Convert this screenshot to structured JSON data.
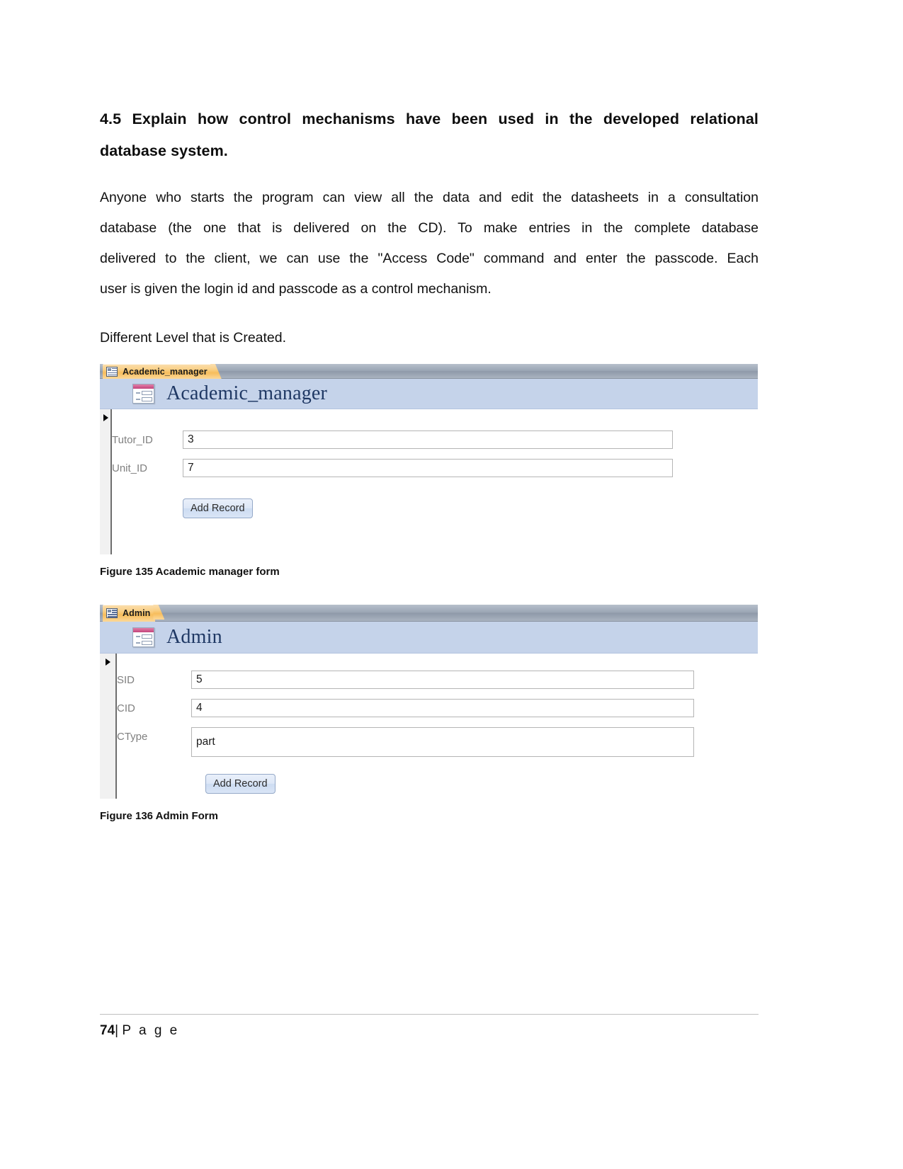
{
  "document": {
    "heading": {
      "line1": "4.5  Explain  how  control  mechanisms  have  been  used  in  the  developed  relational",
      "line2": "database system."
    },
    "paragraph1": {
      "line1": "Anyone who starts the program can view all the data and edit the datasheets in a consultation",
      "line2": "database  (the  one  that  is  delivered  on  the  CD).  To  make  entries  in  the  complete  database",
      "line3": "delivered to the client, we can use the \"Access Code\" command and enter the passcode. Each",
      "line4": "user is given the login id and passcode as a control mechanism."
    },
    "paragraph2": "Different Level that is Created."
  },
  "figures": [
    {
      "id": "academic-manager",
      "tab_label": "Academic_manager",
      "tab_icon": "form-view-icon",
      "form_title": "Academic_manager",
      "form_title_icon": "form-icon",
      "record_selector_icon": "record-selector-arrow-icon",
      "fields": [
        {
          "label": "Tutor_ID",
          "value": "3",
          "multiline": false
        },
        {
          "label": "Unit_ID",
          "value": "7",
          "multiline": false
        }
      ],
      "button_label": "Add Record",
      "caption": "Figure 135 Academic manager form"
    },
    {
      "id": "admin",
      "tab_label": "Admin",
      "tab_icon": "form-view-icon",
      "form_title": "Admin",
      "form_title_icon": "form-icon",
      "record_selector_icon": "record-selector-arrow-icon",
      "fields": [
        {
          "label": "SID",
          "value": "5",
          "multiline": false
        },
        {
          "label": "CID",
          "value": "4",
          "multiline": false
        },
        {
          "label": "CType",
          "value": "part",
          "multiline": true
        }
      ],
      "button_label": "Add Record",
      "caption": "Figure 136 Admin Form"
    }
  ],
  "footer": {
    "page_number": "74",
    "separator": "|",
    "page_word": "P a g e"
  },
  "colors": {
    "heading_text": "#0d0d0d",
    "body_text": "#111111",
    "form_header_band": "#c5d3ea",
    "form_title_text": "#1f3864",
    "tab_active": "#f9cf85",
    "tabbar": "#9aa5b4",
    "field_label": "#808080",
    "button_face": "#cddcf2"
  }
}
